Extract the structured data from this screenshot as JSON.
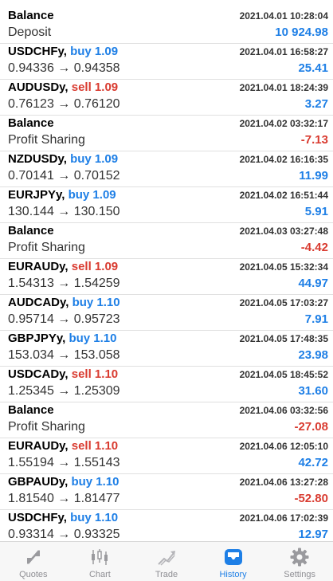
{
  "history": [
    {
      "type": "balance",
      "title": "Balance",
      "subtitle": "Deposit",
      "time": "2021.04.01 10:28:04",
      "amount": "10 924.98",
      "amount_sign": "pos"
    },
    {
      "type": "trade",
      "symbol": "USDCHFy,",
      "direction": "buy 1.09",
      "dir_class": "buy",
      "prices": "0.94336 → 0.94358",
      "time": "2021.04.01 16:58:27",
      "amount": "25.41",
      "amount_sign": "pos"
    },
    {
      "type": "trade",
      "symbol": "AUDUSDy,",
      "direction": "sell 1.09",
      "dir_class": "sell",
      "prices": "0.76123 → 0.76120",
      "time": "2021.04.01 18:24:39",
      "amount": "3.27",
      "amount_sign": "pos"
    },
    {
      "type": "balance",
      "title": "Balance",
      "subtitle": "Profit Sharing",
      "time": "2021.04.02 03:32:17",
      "amount": "-7.13",
      "amount_sign": "neg"
    },
    {
      "type": "trade",
      "symbol": "NZDUSDy,",
      "direction": "buy 1.09",
      "dir_class": "buy",
      "prices": "0.70141 → 0.70152",
      "time": "2021.04.02 16:16:35",
      "amount": "11.99",
      "amount_sign": "pos"
    },
    {
      "type": "trade",
      "symbol": "EURJPYy,",
      "direction": "buy 1.09",
      "dir_class": "buy",
      "prices": "130.144 → 130.150",
      "time": "2021.04.02 16:51:44",
      "amount": "5.91",
      "amount_sign": "pos"
    },
    {
      "type": "balance",
      "title": "Balance",
      "subtitle": "Profit Sharing",
      "time": "2021.04.03 03:27:48",
      "amount": "-4.42",
      "amount_sign": "neg"
    },
    {
      "type": "trade",
      "symbol": "EURAUDy,",
      "direction": "sell 1.09",
      "dir_class": "sell",
      "prices": "1.54313 → 1.54259",
      "time": "2021.04.05 15:32:34",
      "amount": "44.97",
      "amount_sign": "pos"
    },
    {
      "type": "trade",
      "symbol": "AUDCADy,",
      "direction": "buy 1.10",
      "dir_class": "buy",
      "prices": "0.95714 → 0.95723",
      "time": "2021.04.05 17:03:27",
      "amount": "7.91",
      "amount_sign": "pos"
    },
    {
      "type": "trade",
      "symbol": "GBPJPYy,",
      "direction": "buy 1.10",
      "dir_class": "buy",
      "prices": "153.034 → 153.058",
      "time": "2021.04.05 17:48:35",
      "amount": "23.98",
      "amount_sign": "pos"
    },
    {
      "type": "trade",
      "symbol": "USDCADy,",
      "direction": "sell 1.10",
      "dir_class": "sell",
      "prices": "1.25345 → 1.25309",
      "time": "2021.04.05 18:45:52",
      "amount": "31.60",
      "amount_sign": "pos"
    },
    {
      "type": "balance",
      "title": "Balance",
      "subtitle": "Profit Sharing",
      "time": "2021.04.06 03:32:56",
      "amount": "-27.08",
      "amount_sign": "neg"
    },
    {
      "type": "trade",
      "symbol": "EURAUDy,",
      "direction": "sell 1.10",
      "dir_class": "sell",
      "prices": "1.55194 → 1.55143",
      "time": "2021.04.06 12:05:10",
      "amount": "42.72",
      "amount_sign": "pos"
    },
    {
      "type": "trade",
      "symbol": "GBPAUDy,",
      "direction": "buy 1.10",
      "dir_class": "buy",
      "prices": "1.81540 → 1.81477",
      "time": "2021.04.06 13:27:28",
      "amount": "-52.80",
      "amount_sign": "neg"
    },
    {
      "type": "trade",
      "symbol": "USDCHFy,",
      "direction": "buy 1.10",
      "dir_class": "buy",
      "prices": "0.93314 → 0.93325",
      "time": "2021.04.06 17:02:39",
      "amount": "12.97",
      "amount_sign": "pos"
    }
  ],
  "tabbar": {
    "tabs": [
      {
        "label": "Quotes",
        "icon": "quotes-icon"
      },
      {
        "label": "Chart",
        "icon": "chart-icon"
      },
      {
        "label": "Trade",
        "icon": "trade-icon"
      },
      {
        "label": "History",
        "icon": "history-icon",
        "active": true
      },
      {
        "label": "Settings",
        "icon": "settings-icon"
      }
    ]
  },
  "colors": {
    "accent_blue": "#1e7fe6",
    "loss_red": "#d93b30",
    "tab_inactive": "#8e8e93"
  }
}
